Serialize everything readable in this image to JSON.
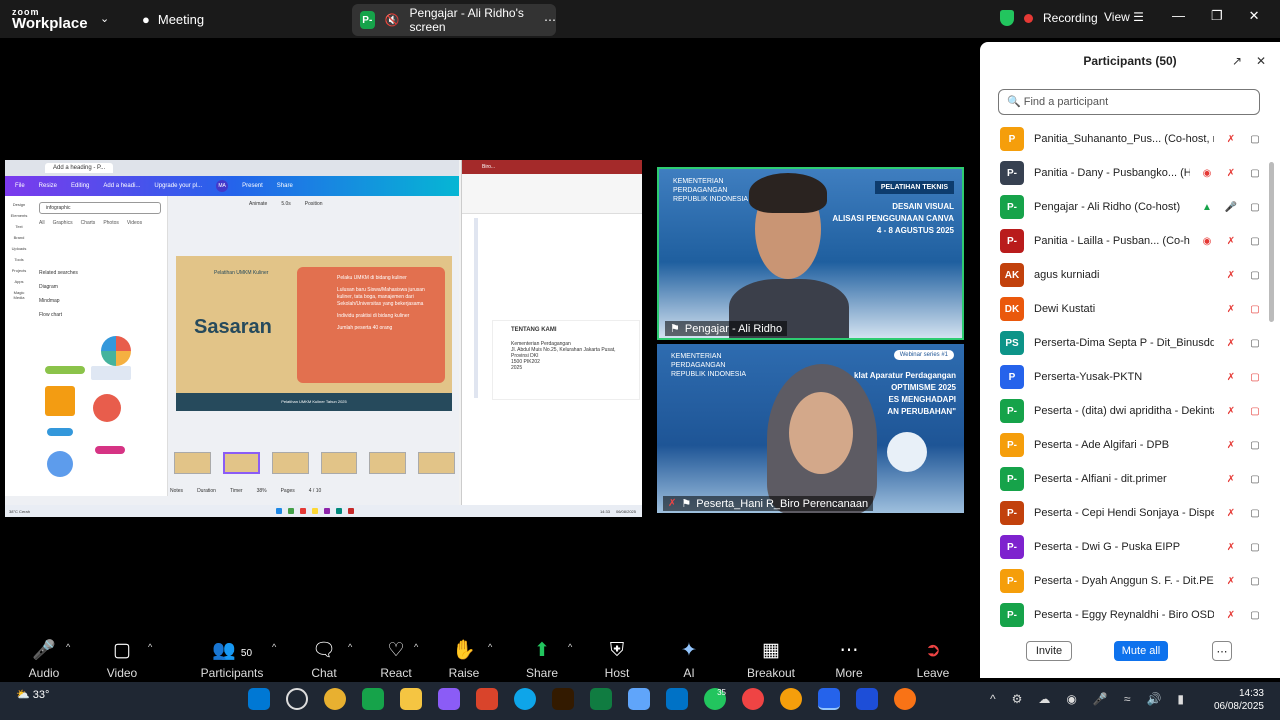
{
  "topbar": {
    "logo_top": "zoom",
    "logo_bottom": "Workplace",
    "meeting_label": "Meeting",
    "share_badge": "P-",
    "share_title": "Pengajar - Ali Ridho's screen",
    "recording_label": "Recording",
    "view_label": "View"
  },
  "shared_screen": {
    "canva_tab": "Add a heading - P...",
    "toolbar": [
      "File",
      "Resize",
      "Editing",
      "Add a headi...",
      "Upgrade your pl..."
    ],
    "avatar": "MA",
    "present": "Present",
    "share": "Share",
    "sidebar": [
      "Design",
      "Elements",
      "Text",
      "Brand",
      "Uploads",
      "Tools",
      "Projects",
      "Apps",
      "Magic Media"
    ],
    "search_value": "infographic",
    "panel_tabs": [
      "All",
      "Graphics",
      "Charts",
      "Photos",
      "Videos"
    ],
    "related_heading": "Related searches",
    "related": [
      "Diagram",
      "Mindmap",
      "Flow chart"
    ],
    "slide_toolbar": [
      "Animate",
      "5.0s",
      "Position"
    ],
    "slide_kuliner": "Pelatihan UMKM Kuliner",
    "slide_title": "Sasaran",
    "slide_bullets": [
      "Pelaku UMKM di bidang kuliner",
      "Lulusan baru Siswa/Mahasiswa jurusan kuliner, tata boga, manajemen dari Sekolah/Universitas yang bekerjasama",
      "Individu praktisi di bidang kuliner",
      "Jumlah peserta 40 orang"
    ],
    "slide_footer": "Pelatihan UMKM Kuliner Tahun 2025",
    "statusbar": [
      "Notes",
      "Duration",
      "Timer",
      "38%",
      "Pages",
      "4 / 10"
    ],
    "word_title": "Biro...",
    "word_heading": "TENTANG KAMI",
    "word_lines": [
      "Kementerian Perdagangan",
      "Jl. Abdul Muis No.25, Kelurahan Jakarta Pusat, Provinsi DKI",
      "1500 PIK202",
      "2025"
    ],
    "taskbar_weather": "38°C Cerah",
    "taskbar_time": "14:33",
    "taskbar_date": "06/08/2025"
  },
  "videos": [
    {
      "banner": "KEMENTERIAN PERDAGANGAN REPUBLIK INDONESIA",
      "tag": "PELATIHAN TEKNIS",
      "text": [
        "DESAIN VISUAL",
        "ALISASI PENGGUNAAN CANVA",
        "4 - 8 AGUSTUS 2025"
      ],
      "name": "Pengajar - Ali Ridho"
    },
    {
      "banner": "KEMENTERIAN PERDAGANGAN REPUBLIK INDONESIA",
      "tag": "Webinar series #1",
      "text": [
        "klat Aparatur Perdagangan",
        "OPTIMISME 2025",
        "ES MENGHADAPI",
        "AN PERUBAHAN\""
      ],
      "name": "Peserta_Hani R_Biro Perencanaan"
    }
  ],
  "participants": {
    "title": "Participants (50)",
    "search_placeholder": "Find a participant",
    "rows": [
      {
        "initials": "P",
        "color": "#f59e0b",
        "name": "Panitia_Suhananto_Pus...",
        "role": "(Co-host, me)"
      },
      {
        "initials": "P-",
        "color": "#374151",
        "name": "Panitia - Dany - Pusbangko...",
        "role": "(Host)"
      },
      {
        "initials": "P-",
        "color": "#16a34a",
        "name": "Pengajar - Ali Ridho",
        "role": "(Co-host)"
      },
      {
        "initials": "P-",
        "color": "#b91c1c",
        "name": "Panitia - Lailla - Pusban...",
        "role": "(Co-host)"
      },
      {
        "initials": "AK",
        "color": "#c2410c",
        "name": "agus kurniadi",
        "role": ""
      },
      {
        "initials": "DK",
        "color": "#ea580c",
        "name": "Dewi Kustati",
        "role": ""
      },
      {
        "initials": "PS",
        "color": "#0d9488",
        "name": "Perserta-Dima Septa P - Dit_Binusddag",
        "role": ""
      },
      {
        "initials": "P",
        "color": "#2563eb",
        "name": "Perserta-Yusak-PKTN",
        "role": ""
      },
      {
        "initials": "P-",
        "color": "#16a34a",
        "name": "Peserta - (dita) dwi apriditha - Dekinta...",
        "role": ""
      },
      {
        "initials": "P-",
        "color": "#f59e0b",
        "name": "Peserta - Ade Algifari - DPB",
        "role": ""
      },
      {
        "initials": "P-",
        "color": "#16a34a",
        "name": "Peserta - Alfiani - dit.primer",
        "role": ""
      },
      {
        "initials": "P-",
        "color": "#c2410c",
        "name": "Peserta - Cepi Hendi Sonjaya - Disper...",
        "role": ""
      },
      {
        "initials": "P-",
        "color": "#7e22ce",
        "name": "Peserta - Dwi G - Puska EIPP",
        "role": ""
      },
      {
        "initials": "P-",
        "color": "#f59e0b",
        "name": "Peserta - Dyah Anggun S. F. - Dit.PEPP",
        "role": ""
      },
      {
        "initials": "P-",
        "color": "#16a34a",
        "name": "Peserta - Eggy Reynaldhi - Biro OSDM",
        "role": ""
      }
    ],
    "invite": "Invite",
    "mute_all": "Mute all"
  },
  "toolbar": {
    "audio": "Audio",
    "video": "Video",
    "participants": "Participants",
    "participants_count": "50",
    "chat": "Chat",
    "react": "React",
    "raise_hand": "Raise hand",
    "share": "Share",
    "host_tools": "Host tools",
    "ai_companion": "AI Companion",
    "breakout": "Breakout rooms",
    "more": "More",
    "leave": "Leave"
  },
  "taskbar": {
    "temp": "33°",
    "whatsapp_badge": "35",
    "time": "14:33",
    "date": "06/08/2025"
  }
}
